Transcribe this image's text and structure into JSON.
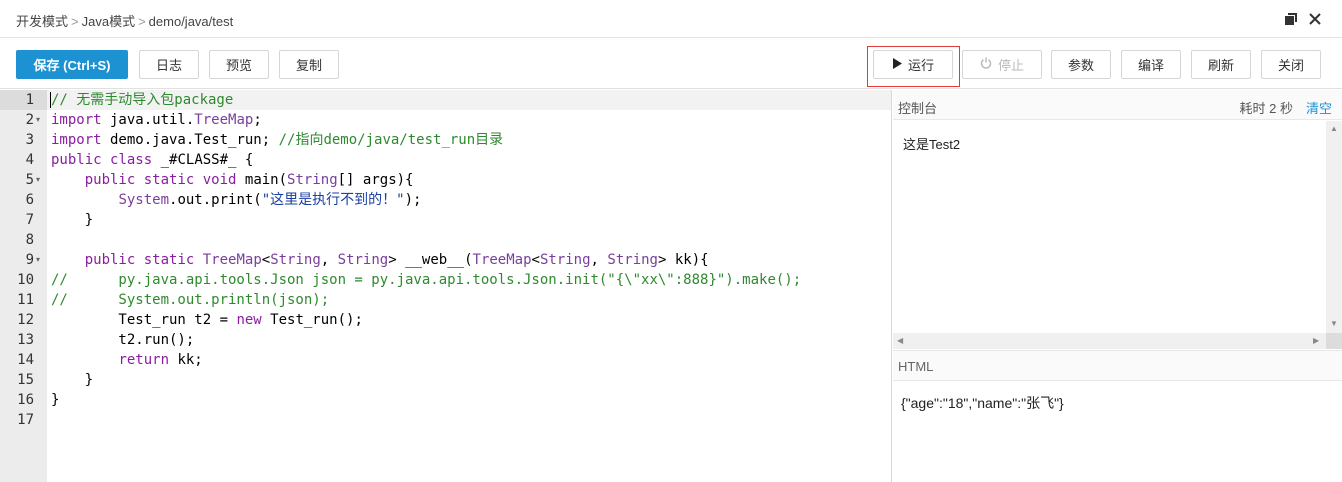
{
  "breadcrumb": {
    "items": [
      "开发模式",
      "Java模式",
      "demo/java/test"
    ],
    "separator": ">"
  },
  "window": {
    "maximize_icon": "restore-window-icon",
    "close_icon": "close-icon"
  },
  "toolbar": {
    "save_label": "保存 (Ctrl+S)",
    "log_label": "日志",
    "preview_label": "预览",
    "copy_label": "复制",
    "run_label": "运行",
    "run_icon": "play-icon",
    "stop_label": "停止",
    "stop_icon": "power-icon",
    "params_label": "参数",
    "compile_label": "编译",
    "refresh_label": "刷新",
    "close_label": "关闭"
  },
  "colors": {
    "primary": "#1d92d3",
    "highlight_border": "#e23b3b",
    "link": "#1d92d3"
  },
  "editor": {
    "line_numbers": [
      "1",
      "2",
      "3",
      "4",
      "5",
      "6",
      "7",
      "8",
      "9",
      "10",
      "11",
      "12",
      "13",
      "14",
      "15",
      "16",
      "17"
    ],
    "fold_lines": [
      2,
      5,
      9
    ],
    "lines": [
      "// 无需手动导入包package",
      "import java.util.TreeMap;",
      "import demo.java.Test_run; //指向demo/java/test_run目录",
      "public class _#CLASS#_ {",
      "    public static void main(String[] args){",
      "        System.out.print(\"这里是执行不到的！\");",
      "    }",
      "",
      "    public static TreeMap<String, String> __web__(TreeMap<String, String> kk){",
      "//      py.java.api.tools.Json json = py.java.api.tools.Json.init(\"{\\\"xx\\\":888}\").make();",
      "//      System.out.println(json);",
      "        Test_run t2 = new Test_run();",
      "        t2.run();",
      "        return kk;",
      "    }",
      "}",
      ""
    ]
  },
  "console": {
    "title": "控制台",
    "time_label": "耗时 2 秒",
    "clear_label": "清空",
    "output": "这是Test2"
  },
  "html_panel": {
    "title": "HTML",
    "content": "{\"age\":\"18\",\"name\":\"张飞\"}"
  }
}
